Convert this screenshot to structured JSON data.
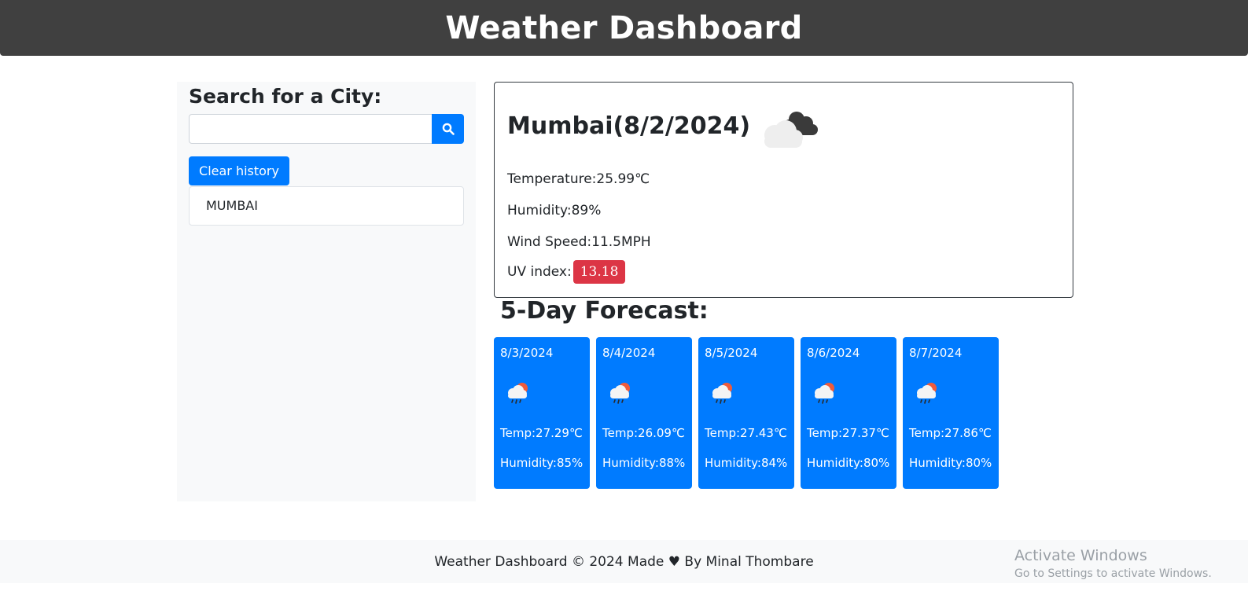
{
  "header": {
    "title": "Weather Dashboard"
  },
  "sidebar": {
    "heading": "Search for a City:",
    "search": {
      "value": "",
      "placeholder": ""
    },
    "search_button_icon": "search-icon",
    "clear_label": "Clear history",
    "history": [
      "MUMBAI"
    ]
  },
  "current": {
    "title": "Mumbai(8/2/2024)",
    "icon": "cloudy-icon",
    "temperature": "Temperature:25.99℃",
    "humidity": "Humidity:89%",
    "wind": "Wind Speed:11.5MPH",
    "uv_label": "UV index:",
    "uv_value": "13.18",
    "uv_color": "#dc3545"
  },
  "forecast": {
    "heading": "5-Day Forecast:",
    "card_color": "#007bff",
    "days": [
      {
        "date": "8/3/2024",
        "icon": "rain-sun-icon",
        "temp": "Temp:27.29℃",
        "humidity": "Humidity:85%"
      },
      {
        "date": "8/4/2024",
        "icon": "rain-sun-icon",
        "temp": "Temp:26.09℃",
        "humidity": "Humidity:88%"
      },
      {
        "date": "8/5/2024",
        "icon": "rain-sun-icon",
        "temp": "Temp:27.43℃",
        "humidity": "Humidity:84%"
      },
      {
        "date": "8/6/2024",
        "icon": "rain-sun-icon",
        "temp": "Temp:27.37℃",
        "humidity": "Humidity:80%"
      },
      {
        "date": "8/7/2024",
        "icon": "rain-sun-icon",
        "temp": "Temp:27.86℃",
        "humidity": "Humidity:80%"
      }
    ]
  },
  "footer": {
    "text": "Weather Dashboard © 2024 Made ♥ By Minal Thombare"
  },
  "watermark": {
    "title": "Activate Windows",
    "subtitle": "Go to Settings to activate Windows."
  }
}
